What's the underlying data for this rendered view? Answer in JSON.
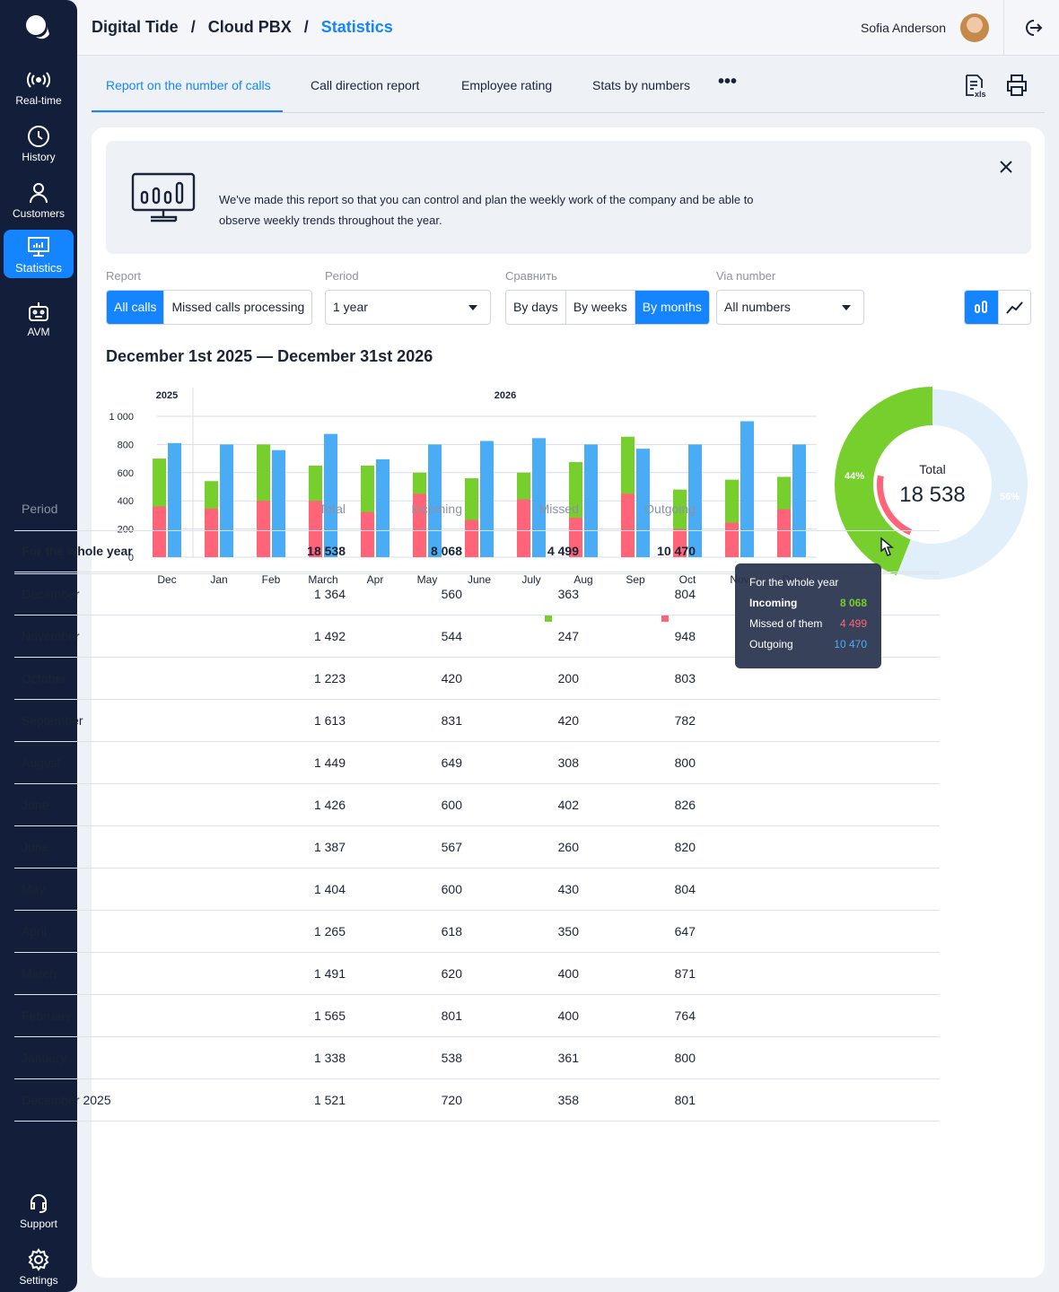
{
  "sidebar": {
    "items": [
      {
        "label": "Real-time",
        "icon": "broadcast-icon"
      },
      {
        "label": "History",
        "icon": "clock-icon"
      },
      {
        "label": "Customers",
        "icon": "user-icon"
      },
      {
        "label": "Statistics",
        "icon": "monitor-chart-icon"
      },
      {
        "label": "AVM",
        "icon": "robot-icon"
      }
    ],
    "bottom": [
      {
        "label": "Support",
        "icon": "headset-icon"
      },
      {
        "label": "Settings",
        "icon": "gear-icon"
      }
    ]
  },
  "header": {
    "breadcrumbs": [
      "Digital Tide",
      "Cloud PBX",
      "Statistics"
    ],
    "separator": "/",
    "user": "Sofia Anderson"
  },
  "tabs": [
    "Report on the number of calls",
    "Call direction report",
    "Employee rating",
    "Stats by numbers"
  ],
  "banner": {
    "text": "We've made this report so that you can control and plan the weekly work of the company and be able to observe weekly trends throughout the year."
  },
  "filters": {
    "report_label": "Report",
    "report_options": [
      "All calls",
      "Missed calls processing"
    ],
    "period_label": "Period",
    "period_value": "1 year",
    "compare_label": "Сравнить",
    "compare_options": [
      "By days",
      "By weeks",
      "By months"
    ],
    "via_label": "Via number",
    "via_value": "All numbers"
  },
  "range": "December 1st 2025 — December 31st 2026",
  "colors": {
    "incoming": "#76cf2c",
    "missed": "#ff6478",
    "outgoing": "#4aacf5",
    "accent": "#1585ff"
  },
  "chart_data": {
    "type": "bar",
    "years": [
      "2025",
      "2026"
    ],
    "categories": [
      "Dec",
      "Jan",
      "Feb",
      "March",
      "Apr",
      "May",
      "June",
      "July",
      "Aug",
      "Sep",
      "Oct",
      "Nov",
      "Dec"
    ],
    "series": [
      {
        "name": "Incoming",
        "values": [
          700,
          540,
          800,
          650,
          650,
          600,
          560,
          600,
          675,
          855,
          480,
          550,
          570
        ]
      },
      {
        "name": "Missed",
        "values": [
          360,
          345,
          400,
          400,
          320,
          450,
          265,
          410,
          280,
          450,
          200,
          245,
          340
        ]
      },
      {
        "name": "Outgoing",
        "values": [
          810,
          800,
          760,
          875,
          695,
          800,
          825,
          845,
          800,
          770,
          800,
          965,
          800
        ]
      }
    ],
    "yticks": [
      "0",
      "200",
      "400",
      "600",
      "800",
      "1 000"
    ],
    "ylim": [
      0,
      1000
    ]
  },
  "donut": {
    "label": "Total",
    "total": "18 538",
    "incoming_pct": "44%",
    "outgoing_pct": "56%",
    "incoming_frac": 0.44,
    "missed_frac": 0.24
  },
  "tooltip": {
    "title": "For the whole year",
    "rows": [
      {
        "label": "Incoming",
        "value": "8 068"
      },
      {
        "label": "Missed of them",
        "value": "4 499"
      },
      {
        "label": "Outgoing",
        "value": "10 470"
      }
    ]
  },
  "table": {
    "headers": [
      "Period",
      "Total",
      "Incoming",
      "Missed",
      "Outgoing"
    ],
    "total_row": [
      "For the whole year",
      "18 538",
      "8 068",
      "4 499",
      "10 470"
    ],
    "rows": [
      [
        "December",
        "1 364",
        "560",
        "363",
        "804"
      ],
      [
        "November",
        "1 492",
        "544",
        "247",
        "948"
      ],
      [
        "October",
        "1 223",
        "420",
        "200",
        "803"
      ],
      [
        "September",
        "1 613",
        "831",
        "420",
        "782"
      ],
      [
        "August",
        "1 449",
        "649",
        "308",
        "800"
      ],
      [
        "June",
        "1 426",
        "600",
        "402",
        "826"
      ],
      [
        "June",
        "1 387",
        "567",
        "260",
        "820"
      ],
      [
        "May",
        "1 404",
        "600",
        "430",
        "804"
      ],
      [
        "April",
        "1 265",
        "618",
        "350",
        "647"
      ],
      [
        "March",
        "1 491",
        "620",
        "400",
        "871"
      ],
      [
        "February",
        "1 565",
        "801",
        "400",
        "764"
      ],
      [
        "January",
        "1 338",
        "538",
        "361",
        "800"
      ],
      [
        "December 2025",
        "1 521",
        "720",
        "358",
        "801"
      ]
    ]
  }
}
